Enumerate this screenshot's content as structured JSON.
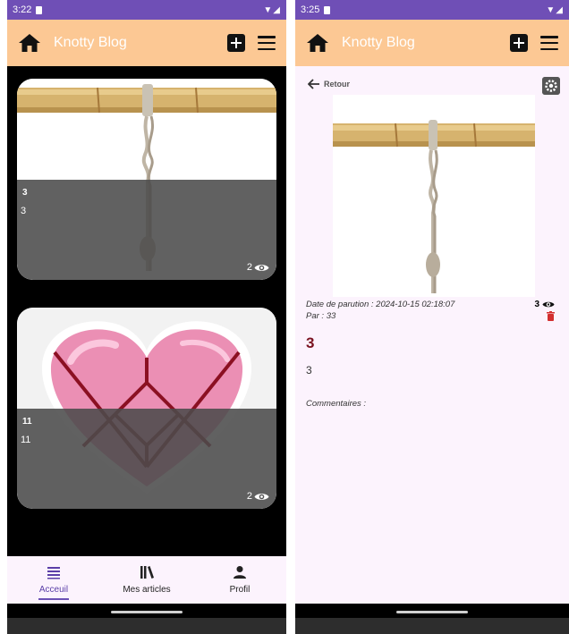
{
  "screen_feed": {
    "status": {
      "time": "3:22",
      "signal": "▼◢"
    },
    "appbar": {
      "title": "Knotty Blog"
    },
    "articles": [
      {
        "title": "3",
        "text": "3",
        "views": "2"
      },
      {
        "title": "11",
        "text": "11",
        "views": "2"
      }
    ],
    "bottom_nav": [
      {
        "label": "Acceuil",
        "icon": "list-icon",
        "active": true
      },
      {
        "label": "Mes articles",
        "icon": "library-icon",
        "active": false
      },
      {
        "label": "Profil",
        "icon": "person-icon",
        "active": false
      }
    ]
  },
  "screen_detail": {
    "status": {
      "time": "3:25",
      "signal": "▼◢"
    },
    "appbar": {
      "title": "Knotty Blog"
    },
    "back_label": "Retour",
    "date_line": "Date de parution : 2024-10-15 02:18:07",
    "author_line": "Par : 33",
    "views": "3",
    "title": "3",
    "body": "3",
    "comments_label": "Commentaires :"
  },
  "colors": {
    "status_bar": "#6f4fb6",
    "app_bar": "#fcc894",
    "page_bg": "#fcf3fd",
    "accent": "#6b51b5",
    "title_red": "#7a1220",
    "delete_red": "#d32f2f"
  }
}
